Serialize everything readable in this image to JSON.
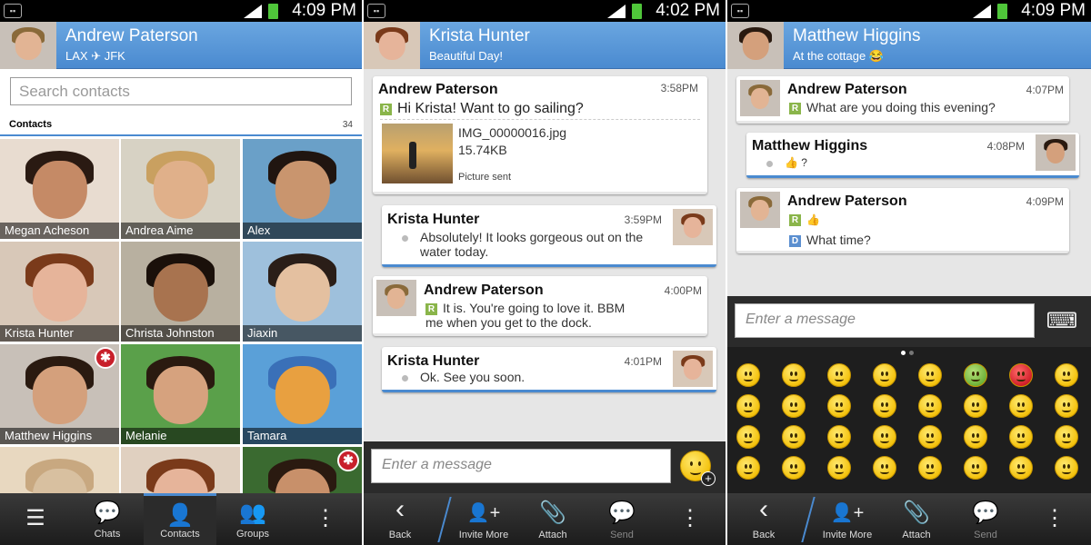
{
  "status_bars": [
    {
      "time": "4:09 PM"
    },
    {
      "time": "4:02 PM"
    },
    {
      "time": "4:09 PM"
    }
  ],
  "contacts_screen": {
    "header": {
      "name": "Andrew Paterson",
      "subtitle_from": "LAX",
      "subtitle_plane": "✈",
      "subtitle_to": "JFK"
    },
    "search_placeholder": "Search contacts",
    "contacts_label": "Contacts",
    "contacts_count": "34",
    "tiles": [
      {
        "name": "Megan Acheson",
        "skin": "#c58a66",
        "hair": "#2a1a12",
        "bg": "#e8dcd0",
        "badge": false
      },
      {
        "name": "Andrea Aime",
        "skin": "#e0b08a",
        "hair": "#c9a060",
        "bg": "#d7d2c4",
        "badge": false
      },
      {
        "name": "Alex",
        "skin": "#c9956e",
        "hair": "#201510",
        "bg": "#6aa0c8",
        "badge": false
      },
      {
        "name": "Krista Hunter",
        "skin": "#e6b49a",
        "hair": "#7a3a1a",
        "bg": "#d8c8b8",
        "badge": false
      },
      {
        "name": "Christa Johnston",
        "skin": "#a8734f",
        "hair": "#1a100a",
        "bg": "#b8b0a0",
        "badge": false
      },
      {
        "name": "Jiaxin",
        "skin": "#e4c0a0",
        "hair": "#2a1e18",
        "bg": "#9ec0dc",
        "badge": false
      },
      {
        "name": "Matthew Higgins",
        "skin": "#d4a07c",
        "hair": "#2a1a10",
        "bg": "#c8c0b8",
        "badge": true
      },
      {
        "name": "Melanie",
        "skin": "#d6a27e",
        "hair": "#2a1a10",
        "bg": "#5aa04a",
        "badge": false
      },
      {
        "name": "Tamara",
        "skin": "#e8a040",
        "hair": "#3a70b8",
        "bg": "#5aa0d8",
        "badge": false
      },
      {
        "name": "",
        "skin": "#d8c0a0",
        "hair": "#c8a880",
        "bg": "#e8d8c0",
        "badge": false
      },
      {
        "name": "",
        "skin": "#e6b49a",
        "hair": "#7a3a1a",
        "bg": "#e0d0c0",
        "badge": false
      },
      {
        "name": "",
        "skin": "#c8906a",
        "hair": "#2a1a10",
        "bg": "#3a6a30",
        "badge": true
      }
    ],
    "badge_glyph": "✱",
    "nav": [
      {
        "icon": "☰",
        "label": ""
      },
      {
        "icon": "💬",
        "label": "Chats"
      },
      {
        "icon": "👤",
        "label": "Contacts"
      },
      {
        "icon": "👥",
        "label": "Groups"
      },
      {
        "icon": "⋮",
        "label": ""
      }
    ]
  },
  "chat_krista": {
    "header": {
      "name": "Krista Hunter",
      "subtitle": "Beautiful Day!"
    },
    "messages": [
      {
        "sender": "Andrew Paterson",
        "time": "3:58PM",
        "text": "Hi Krista! Want to go sailing?",
        "file_name": "IMG_00000016.jpg",
        "file_size": "15.74KB",
        "file_status": "Picture sent"
      },
      {
        "sender": "Krista Hunter",
        "time": "3:59PM",
        "text": "Absolutely! It looks gorgeous out on the water today."
      },
      {
        "sender": "Andrew Paterson",
        "time": "4:00PM",
        "text": "It is. You're going to love it. BBM me when you get to the dock."
      },
      {
        "sender": "Krista Hunter",
        "time": "4:01PM",
        "text": "Ok. See you soon."
      }
    ],
    "r_badge": "R",
    "input_placeholder": "Enter a message",
    "nav": [
      {
        "icon": "‹",
        "label": "Back"
      },
      {
        "icon": "👤+",
        "label": "Invite More"
      },
      {
        "icon": "📎",
        "label": "Attach"
      },
      {
        "icon": "💬",
        "label": "Send"
      },
      {
        "icon": "⋮",
        "label": ""
      }
    ]
  },
  "chat_matthew": {
    "header": {
      "name": "Matthew Higgins",
      "subtitle": "At the cottage",
      "subtitle_emoji": "😂"
    },
    "messages": [
      {
        "sender": "Andrew Paterson",
        "time": "4:07PM",
        "text": "What are you doing this evening?"
      },
      {
        "sender": "Matthew Higgins",
        "time": "4:08PM",
        "text": "👍 ?"
      },
      {
        "sender": "Andrew Paterson",
        "time": "4:09PM",
        "text": "👍",
        "text2": "What time?"
      }
    ],
    "r_badge": "R",
    "d_badge": "D",
    "input_placeholder": "Enter a message",
    "keyboard_icon": "⌨",
    "emoji_count": 32,
    "nav": [
      {
        "icon": "‹",
        "label": "Back"
      },
      {
        "icon": "👤+",
        "label": "Invite More"
      },
      {
        "icon": "📎",
        "label": "Attach"
      },
      {
        "icon": "💬",
        "label": "Send"
      },
      {
        "icon": "⋮",
        "label": ""
      }
    ]
  }
}
